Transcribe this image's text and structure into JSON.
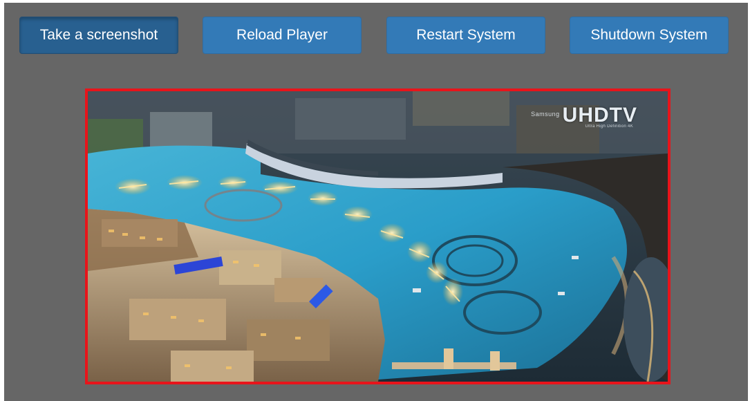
{
  "toolbar": {
    "buttons": [
      {
        "label": "Take a screenshot",
        "active": true
      },
      {
        "label": "Reload Player",
        "active": false
      },
      {
        "label": "Restart System",
        "active": false
      },
      {
        "label": "Shutdown System",
        "active": false
      }
    ]
  },
  "player": {
    "border_color": "#e8141b",
    "watermark": {
      "brand": "Samsung",
      "title": "UHDTV",
      "tagline": "Ultra High Definition 4K"
    }
  },
  "colors": {
    "panel_bg": "#666666",
    "button_bg": "#337ab7",
    "button_active_bg": "#286090",
    "button_text": "#ffffff"
  }
}
